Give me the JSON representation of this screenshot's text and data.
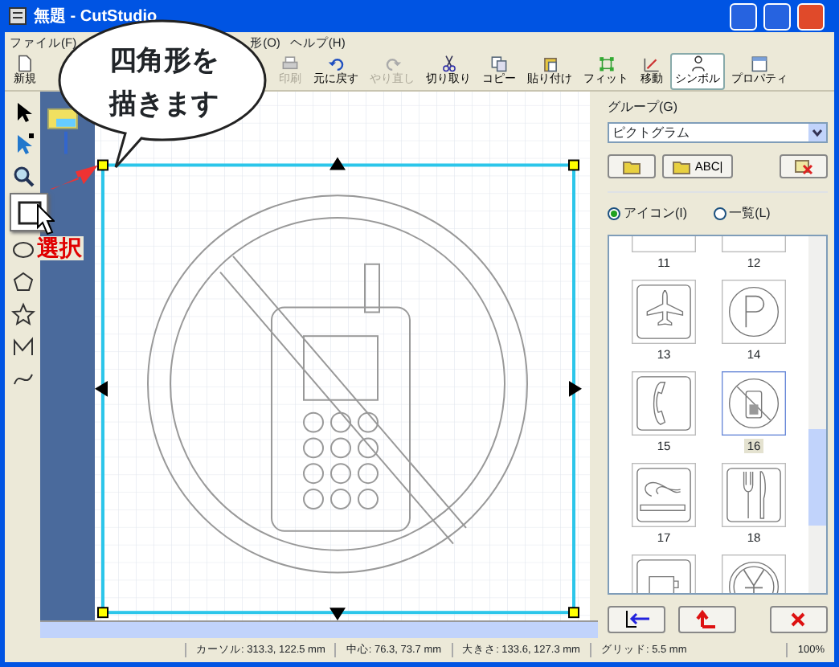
{
  "window": {
    "title": "無題 - CutStudio"
  },
  "menu": [
    {
      "label": "ファイル(F)"
    },
    {
      "label": "形(O)"
    },
    {
      "label": "ヘルプ(H)"
    }
  ],
  "toolbar": [
    {
      "kind": "new",
      "label": "新規",
      "disabled": false,
      "selected": false
    },
    {
      "kind": "print",
      "label": "印刷",
      "disabled": true,
      "selected": false
    },
    {
      "kind": "undo",
      "label": "元に戻す",
      "disabled": false,
      "selected": false
    },
    {
      "kind": "redo",
      "label": "やり直し",
      "disabled": true,
      "selected": false
    },
    {
      "kind": "cut",
      "label": "切り取り",
      "disabled": false,
      "selected": false
    },
    {
      "kind": "copy",
      "label": "コピー",
      "disabled": false,
      "selected": false
    },
    {
      "kind": "paste",
      "label": "貼り付け",
      "disabled": false,
      "selected": false
    },
    {
      "kind": "fit",
      "label": "フィット",
      "disabled": false,
      "selected": false
    },
    {
      "kind": "move",
      "label": "移動",
      "disabled": false,
      "selected": false
    },
    {
      "kind": "symbol",
      "label": "シンボル",
      "disabled": false,
      "selected": true
    },
    {
      "kind": "props",
      "label": "プロパティ",
      "disabled": false,
      "selected": false
    }
  ],
  "tools": [
    {
      "kind": "select",
      "selected": false
    },
    {
      "kind": "node",
      "selected": false
    },
    {
      "kind": "zoom",
      "selected": false
    },
    {
      "kind": "rect",
      "selected": true
    },
    {
      "kind": "ellipse",
      "selected": false
    },
    {
      "kind": "pentagon",
      "selected": false
    },
    {
      "kind": "star",
      "selected": false
    },
    {
      "kind": "polyline",
      "selected": false
    },
    {
      "kind": "curve",
      "selected": false
    }
  ],
  "callout": {
    "text": "四角形を描きます"
  },
  "tool_caption": "選択",
  "panel": {
    "group_label": "グループ(G)",
    "group_value": "ピクトグラム",
    "buttons": [
      {
        "kind": "open"
      },
      {
        "kind": "text",
        "label": "ABC|"
      },
      {
        "kind": "delete"
      }
    ],
    "view_modes": [
      {
        "label": "アイコン(I)",
        "selected": true
      },
      {
        "label": "一覧(L)",
        "selected": false
      }
    ],
    "symbols": [
      {
        "kind": "cut",
        "label": "11",
        "selected": false
      },
      {
        "kind": "cut",
        "label": "12",
        "selected": false
      },
      {
        "kind": "plane",
        "label": "13",
        "selected": false
      },
      {
        "kind": "parking",
        "label": "14",
        "selected": false
      },
      {
        "kind": "phone",
        "label": "15",
        "selected": false
      },
      {
        "kind": "nophone",
        "label": "16",
        "selected": true
      },
      {
        "kind": "smoking",
        "label": "17",
        "selected": false
      },
      {
        "kind": "dining",
        "label": "18",
        "selected": false
      },
      {
        "kind": "cup",
        "selected": false
      },
      {
        "kind": "yen",
        "selected": false
      }
    ],
    "bottom_buttons": [
      {
        "kind": "import"
      },
      {
        "kind": "back"
      },
      {
        "kind": "close"
      }
    ]
  },
  "status_bar": [
    {
      "text": "カーソル: 313.3, 122.5 mm"
    },
    {
      "text": "中心: 76.3, 73.7 mm"
    },
    {
      "text": "大きさ: 133.6, 127.3 mm"
    },
    {
      "text": "グリッド: 5.5 mm"
    },
    {
      "text": "100%"
    }
  ]
}
